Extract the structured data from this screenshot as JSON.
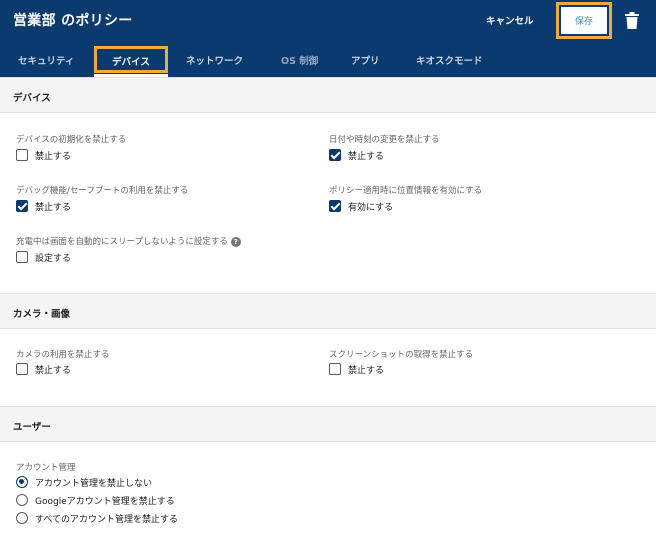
{
  "header": {
    "title": "営業部 のポリシー",
    "cancel_label": "キャンセル",
    "save_label": "保存"
  },
  "tabs": [
    {
      "label": "セキュリティ",
      "active": false
    },
    {
      "label": "デバイス",
      "active": true
    },
    {
      "label": "ネットワーク",
      "active": false
    },
    {
      "label": "OS 制御",
      "active": false
    },
    {
      "label": "アプリ",
      "active": false
    },
    {
      "label": "キオスクモード",
      "active": false
    }
  ],
  "sections": {
    "device": {
      "title": "デバイス",
      "settings": [
        {
          "label": "デバイスの初期化を禁止する",
          "option": "禁止する",
          "checked": false
        },
        {
          "label": "日付や時刻の変更を禁止する",
          "option": "禁止する",
          "checked": true
        },
        {
          "label": "デバッグ機能/セーフブートの利用を禁止する",
          "option": "禁止する",
          "checked": true
        },
        {
          "label": "ポリシー適用時に位置情報を有効にする",
          "option": "有効にする",
          "checked": true
        },
        {
          "label": "充電中は画面を自動的にスリープしないように設定する",
          "option": "設定する",
          "checked": false
        }
      ],
      "help_glyph": "?"
    },
    "camera": {
      "title": "カメラ・画像",
      "settings": [
        {
          "label": "カメラの利用を禁止する",
          "option": "禁止する",
          "checked": false
        },
        {
          "label": "スクリーンショットの取得を禁止する",
          "option": "禁止する",
          "checked": false
        }
      ]
    },
    "user": {
      "title": "ユーザー",
      "account_label": "アカウント管理",
      "radios": [
        {
          "label": "アカウント管理を禁止しない",
          "selected": true
        },
        {
          "label": "Googleアカウント管理を禁止する",
          "selected": false
        },
        {
          "label": "すべてのアカウント管理を禁止する",
          "selected": false
        }
      ]
    }
  },
  "colors": {
    "header_bg": "#0b3a6e",
    "highlight": "#f2a93b",
    "save_text": "#2f8fd8"
  }
}
